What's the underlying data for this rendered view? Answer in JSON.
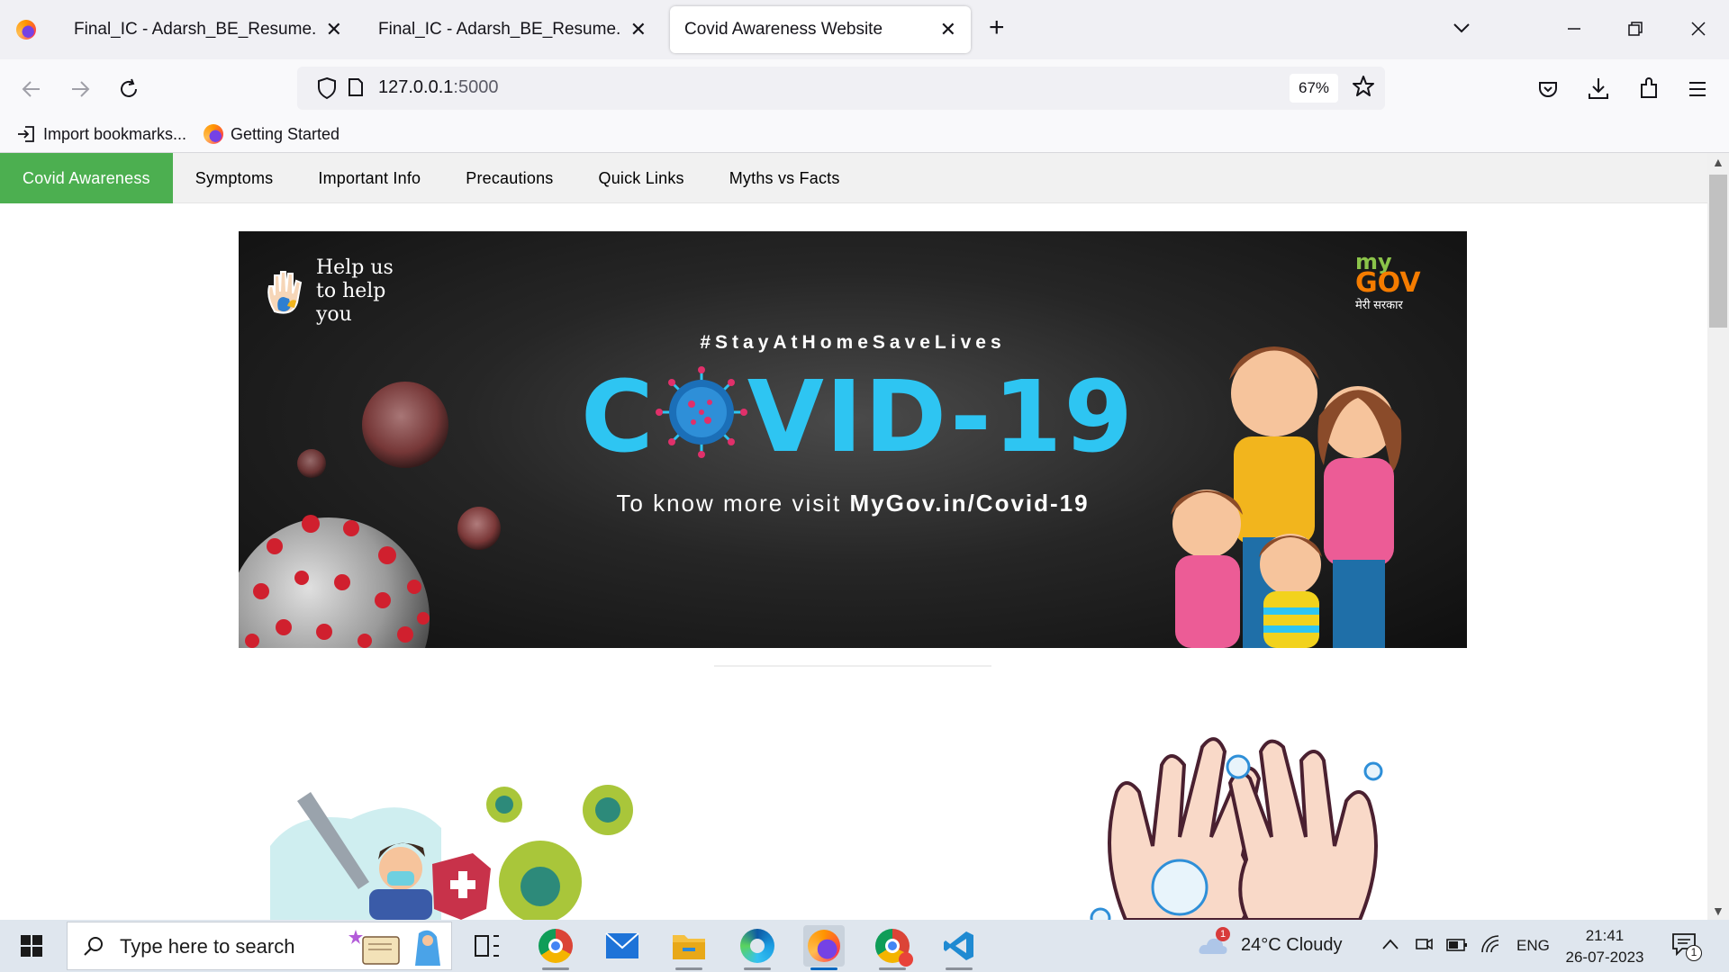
{
  "browser": {
    "tabs": [
      {
        "title": "Final_IC - Adarsh_BE_Resume.pdf",
        "active": false
      },
      {
        "title": "Final_IC - Adarsh_BE_Resume.pdf",
        "active": false
      },
      {
        "title": "Covid Awareness Website",
        "active": true
      }
    ],
    "tab_close_glyph": "✕",
    "new_tab_glyph": "+",
    "url_host": "127.0.0.1",
    "url_port": ":5000",
    "zoom": "67%",
    "bookmarks": [
      {
        "label": "Import bookmarks...",
        "icon": "import-icon"
      },
      {
        "label": "Getting Started",
        "icon": "firefox-icon"
      }
    ]
  },
  "site": {
    "nav": [
      {
        "label": "Covid Awareness",
        "active": true
      },
      {
        "label": "Symptoms",
        "active": false
      },
      {
        "label": "Important Info",
        "active": false
      },
      {
        "label": "Precautions",
        "active": false
      },
      {
        "label": "Quick Links",
        "active": false
      },
      {
        "label": "Myths vs Facts",
        "active": false
      }
    ],
    "banner": {
      "help_text": "Help us to help you",
      "logo_my": "my",
      "logo_gov": "GOV",
      "logo_hindi": "मेरी सरकार",
      "hashtag": "#StayAtHomeSaveLives",
      "title_left": "C",
      "title_right": "VID-19",
      "visit_prefix": "To know more visit ",
      "visit_link": "MyGov.in/Covid-19"
    },
    "colors": {
      "nav_active": "#4caf50",
      "covid_blue": "#2ec5f2",
      "virus_red": "#d0202e"
    }
  },
  "taskbar": {
    "search_placeholder": "Type here to search",
    "apps": [
      "task-view-icon",
      "chrome-icon",
      "mail-icon",
      "file-explorer-icon",
      "edge-icon",
      "firefox-icon",
      "chrome-profile-icon",
      "vscode-icon"
    ],
    "weather": "24°C  Cloudy",
    "weather_badge": "1",
    "language": "ENG",
    "time": "21:41",
    "date": "26-07-2023",
    "notification_count": "1"
  }
}
